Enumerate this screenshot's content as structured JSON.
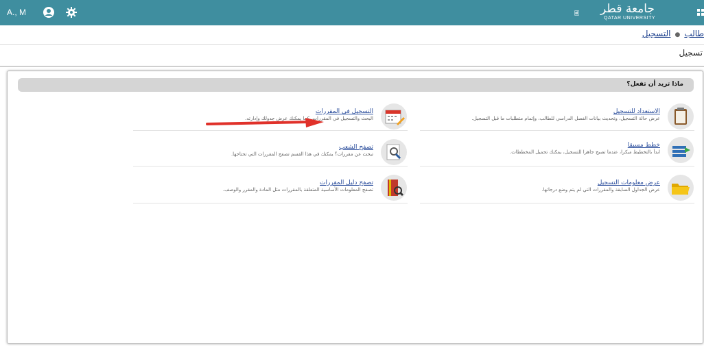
{
  "header": {
    "user": "A., M",
    "logo_ar": "جامعة قطر",
    "logo_en": "QATAR UNIVERSITY",
    "color": "#3f8e9f"
  },
  "breadcrumb": {
    "items": [
      "طالب",
      "التسجيل"
    ]
  },
  "page_title": "تسجيل",
  "question": "ماذا تريد أن تفعل؟",
  "items": [
    {
      "title": "الاستعداد للتسجيل",
      "desc": "عرض حالة التسجيل، وتحديث بيانات الفصل الدراسي للطالب، وإتمام متطلبات ما قبل التسجيل.",
      "icon": "clipboard-icon"
    },
    {
      "title": "التسجيل في المقررات",
      "desc": "البحث والتسجيل في المقررات. كما يمكنك عرض جدولك وإدارته.",
      "icon": "calendar-pencil-icon"
    },
    {
      "title": "خطط مسبقا",
      "desc": "ابدأ بالتخطيط مبكرا، عندما تصبح جاهزا للتسجيل، يمكنك تحميل المخططات.",
      "icon": "plan-arrow-icon"
    },
    {
      "title": "تصفح الشعب",
      "desc": "تبحث عن مقررات؟ يمكنك في هذا القسم تصفح المقررات التي تحتاجها.",
      "icon": "magnifier-icon"
    },
    {
      "title": "عرض معلومات التسجيل",
      "desc": "عرض الجداول السابقة والمقررات التي لم يتم وضع درجاتها.",
      "icon": "folder-icon"
    },
    {
      "title": "تصفح دليل المقررات",
      "desc": "تصفح المعلومات الأساسية المتعلقة بالمقررات مثل المادة والمقرر والوصف.",
      "icon": "book-magnifier-icon"
    }
  ]
}
